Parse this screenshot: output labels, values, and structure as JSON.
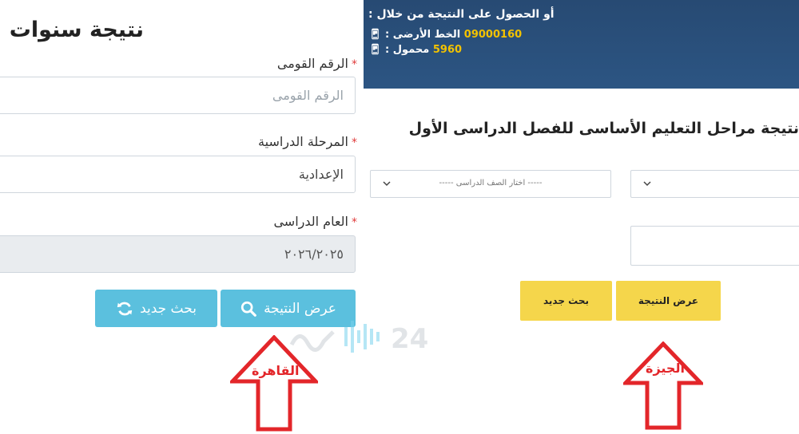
{
  "left": {
    "title": "نتيجة سنوات النقل",
    "national_id_label": "الرقم القومى",
    "national_id_placeholder": "الرقم القومى",
    "stage_label": "المرحلة الدراسية",
    "stage_value": "الإعدادية",
    "year_label": "العام الدراسى",
    "year_value": "٢٠٢٦/٢٠٢٥",
    "required_mark": "*",
    "show_result_label": "عرض النتيجة",
    "new_search_label": "بحث جديد"
  },
  "right": {
    "banner_line1": "أو الحصول على النتيجة من خلال :",
    "landline_label": "الخط الأرضى :",
    "landline_number": "09000160",
    "mobile_label": "محمول :",
    "mobile_number": "5960",
    "title": "نتيجة مراحل التعليم الأساسى للفصل الدراسى الأول",
    "grade_select_placeholder": "----- اختار الصف الدراسى -----",
    "show_result_label": "عرض النتيجة",
    "new_search_label": "بحث جديد"
  },
  "annotations": {
    "cairo_label": "القاهرة",
    "giza_label": "الجيزة",
    "watermark_text": "24"
  },
  "colors": {
    "blue_button": "#5bc0de",
    "yellow_button": "#f5d64b",
    "banner": "#2c5583",
    "arrow": "#e3262a"
  }
}
